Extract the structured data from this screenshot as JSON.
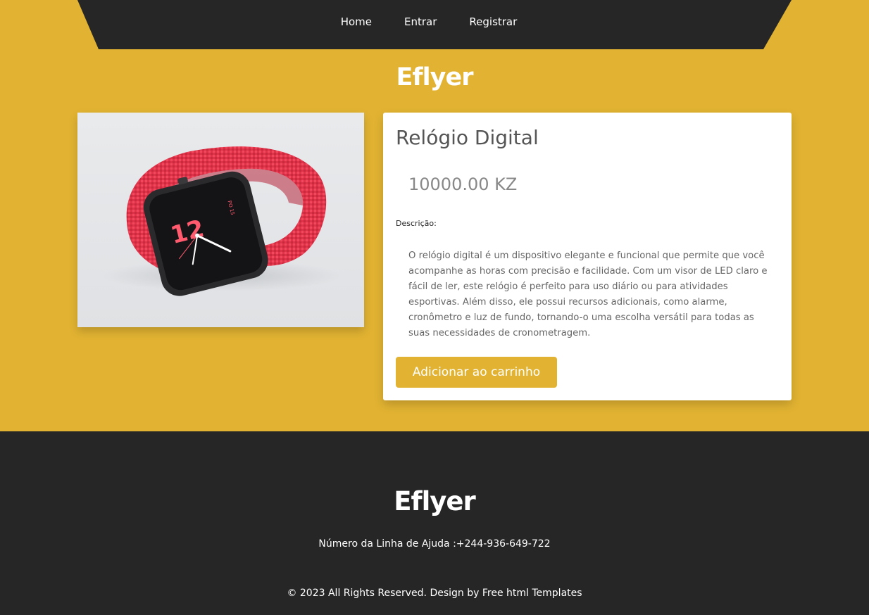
{
  "nav": {
    "items": [
      {
        "label": "Home"
      },
      {
        "label": "Entrar"
      },
      {
        "label": "Registrar"
      }
    ]
  },
  "brand": {
    "name": "Eflyer"
  },
  "product": {
    "title": "Relógio Digital",
    "price": "10000.00 KZ",
    "description_label": "Descrição:",
    "description": "O relógio digital é um dispositivo elegante e funcional que permite que você acompanhe as horas com precisão e facilidade. Com um visor de LED claro e fácil de ler, este relógio é perfeito para uso diário ou para atividades esportivas. Além disso, ele possui recursos adicionais, como alarme, cronômetro e luz de fundo, tornando-o uma escolha versátil para todas as suas necessidades de cronometragem.",
    "add_to_cart_label": "Adicionar ao carrinho",
    "image_watch_face_text": "12",
    "image_watch_date_text": "PO 15"
  },
  "footer": {
    "brand": "Eflyer",
    "helpline": "Número da Linha de Ajuda :+244-936-649-722",
    "copyright": "© 2023 All Rights Reserved. Design by Free html Templates"
  },
  "colors": {
    "accent": "#e2b332",
    "dark": "#262626",
    "card": "#ffffff"
  }
}
